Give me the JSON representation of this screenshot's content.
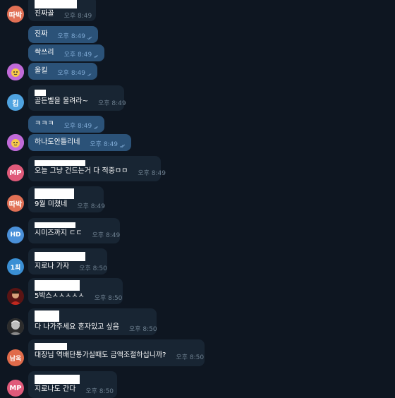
{
  "colors": {
    "background": "#0e1621",
    "incoming_bubble": "#182533",
    "outgoing_bubble": "#2b5278",
    "time_in": "#6d7f8f",
    "time_out": "#7da8d3"
  },
  "messages": [
    {
      "avatar": "따박",
      "avatar_color": "#e17055",
      "text": "진짜골",
      "time": "오후 8:49"
    },
    {
      "text": "진짜",
      "time": "오후 8:49",
      "read_icon": "double-check-icon"
    },
    {
      "text": "싹쓰리",
      "time": "오후 8:49",
      "read_icon": "double-check-icon"
    },
    {
      "avatar_icon": "emoji-avatar-icon",
      "text": "올킬",
      "time": "오후 8:49",
      "read_icon": "double-check-icon"
    },
    {
      "avatar": "킴",
      "avatar_color": "#4fa3e0",
      "text": "골든벨을 울려라~",
      "time": "오후 8:49"
    },
    {
      "text": "ㅋㅋㅋ",
      "time": "오후 8:49",
      "read_icon": "double-check-icon"
    },
    {
      "avatar_icon": "emoji-avatar-icon",
      "text": "하나도안틀리네",
      "time": "오후 8:49",
      "read_icon": "double-check-icon"
    },
    {
      "avatar": "MP",
      "avatar_color": "#e05a7a",
      "text": "오늘 그냥 건드는거 다 적중ㅁㅁ",
      "time": "오후 8:49"
    },
    {
      "avatar": "따박",
      "avatar_color": "#e17055",
      "text": "9월 미쳤네",
      "time": "오후 8:49"
    },
    {
      "avatar": "HD",
      "avatar_color": "#4a90d9",
      "text": "시미즈까지 ㄷㄷ",
      "time": "오후 8:49"
    },
    {
      "avatar": "1최",
      "avatar_color": "#3a8fd4",
      "text": "지로나 가자",
      "time": "오후 8:50"
    },
    {
      "avatar_icon": "photo-avatar-icon",
      "text": "5박스ㅅㅅㅅㅅㅅ",
      "time": "오후 8:50"
    },
    {
      "avatar_icon": "photo-avatar-gray-icon",
      "text": "다 나가주세요 혼자있고 싶음",
      "time": "오후 8:50"
    },
    {
      "avatar": "남욱",
      "avatar_color": "#e06b4a",
      "text": "대장님 역배단통가실때도 금액조절하십니까?",
      "time": "오후 8:50"
    },
    {
      "avatar": "MP",
      "avatar_color": "#e05a7a",
      "text": "지로나도 간다",
      "time": "오후 8:50"
    }
  ]
}
